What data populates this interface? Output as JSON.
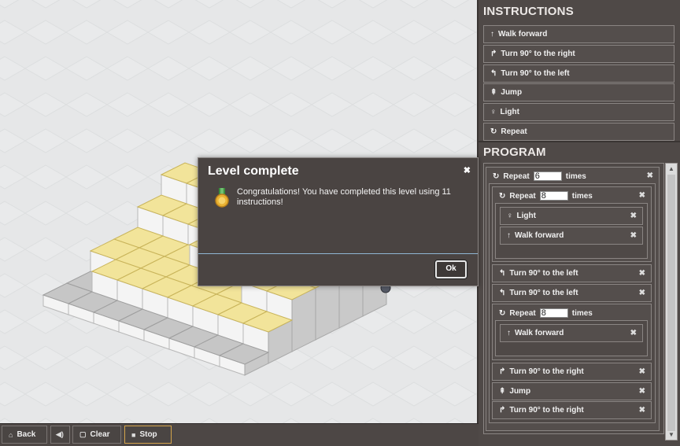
{
  "bottom_bar": {
    "back": "Back",
    "clear": "Clear",
    "stop": "Stop"
  },
  "instructions": {
    "title": "INSTRUCTIONS",
    "items": [
      {
        "icon": "arrow-up-icon",
        "label": "Walk forward"
      },
      {
        "icon": "turn-right-icon",
        "label": "Turn 90° to the right"
      },
      {
        "icon": "turn-left-icon",
        "label": "Turn 90° to the left"
      },
      {
        "icon": "jump-icon",
        "label": "Jump"
      },
      {
        "icon": "bulb-icon",
        "label": "Light"
      },
      {
        "icon": "repeat-icon",
        "label": "Repeat"
      }
    ]
  },
  "program": {
    "title": "PROGRAM",
    "repeat_label": "Repeat",
    "times_label": "times",
    "outer_repeat_count": "6",
    "inner_repeat_count": "8",
    "light": "Light",
    "walk_forward": "Walk forward",
    "turn_left": "Turn 90° to the left",
    "turn_right": "Turn 90° to the right",
    "second_repeat_count": "8",
    "jump": "Jump"
  },
  "dialog": {
    "title": "Level complete",
    "message": "Congratulations! You have completed this level using 11 instructions!",
    "ok": "Ok"
  },
  "colors": {
    "lit_tile": "#f2e49a",
    "panel": "#4f4947",
    "accent_border": "#d4a44c"
  }
}
